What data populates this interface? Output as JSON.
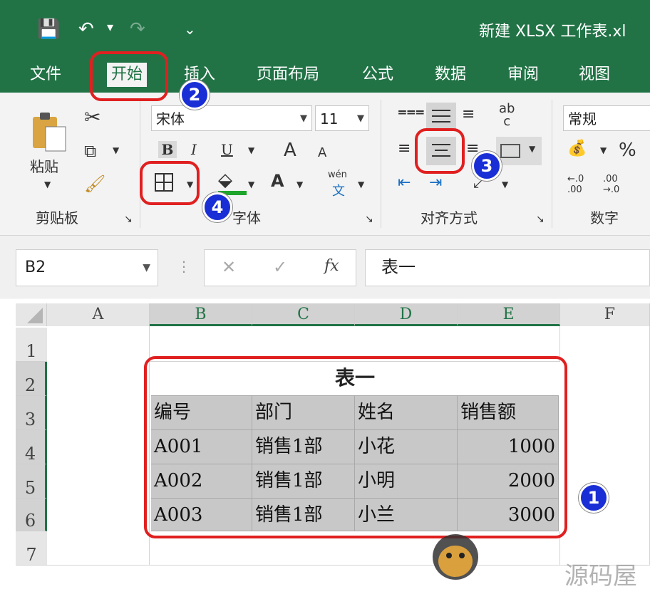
{
  "window": {
    "title": "新建 XLSX 工作表.xl",
    "qat_save": "💾",
    "qat_undo": "↶",
    "qat_redo": "↷",
    "qat_more": "⌄"
  },
  "tabs": [
    "文件",
    "开始",
    "插入",
    "页面布局",
    "公式",
    "数据",
    "审阅",
    "视图"
  ],
  "ribbon": {
    "clipboard": {
      "paste_label": "粘贴",
      "group_label": "剪贴板"
    },
    "font": {
      "font_name": "宋体",
      "font_size": "11",
      "bold": "B",
      "italic": "I",
      "underline": "U",
      "grow": "A",
      "shrink": "A",
      "font_color": "A",
      "phonetic_top": "wén",
      "phonetic_bottom": "文",
      "group_label": "字体"
    },
    "alignment": {
      "wrap_label": "ab\nc",
      "group_label": "对齐方式"
    },
    "number": {
      "format": "常规",
      "percent": "%",
      "inc_decimal": "←.0\n.00",
      "dec_decimal": ".00\n→.0",
      "group_label": "数字"
    }
  },
  "formula_bar": {
    "name_box": "B2",
    "cancel": "✕",
    "enter": "✓",
    "fx": "fx",
    "content": "表一"
  },
  "grid": {
    "columns": [
      "A",
      "B",
      "C",
      "D",
      "E",
      "F"
    ],
    "rows": [
      "1",
      "2",
      "3",
      "4",
      "5",
      "6",
      "7"
    ],
    "table_title": "表一",
    "headers": [
      "编号",
      "部门",
      "姓名",
      "销售额"
    ],
    "data": [
      [
        "A001",
        "销售1部",
        "小花",
        "1000"
      ],
      [
        "A002",
        "销售1部",
        "小明",
        "2000"
      ],
      [
        "A003",
        "销售1部",
        "小兰",
        "3000"
      ]
    ]
  },
  "badges": [
    "1",
    "2",
    "3",
    "4"
  ],
  "watermark": "源码屋",
  "colors": {
    "accent": "#217346",
    "highlight_red": "#e02020",
    "badge_blue": "#1a2ed6"
  }
}
